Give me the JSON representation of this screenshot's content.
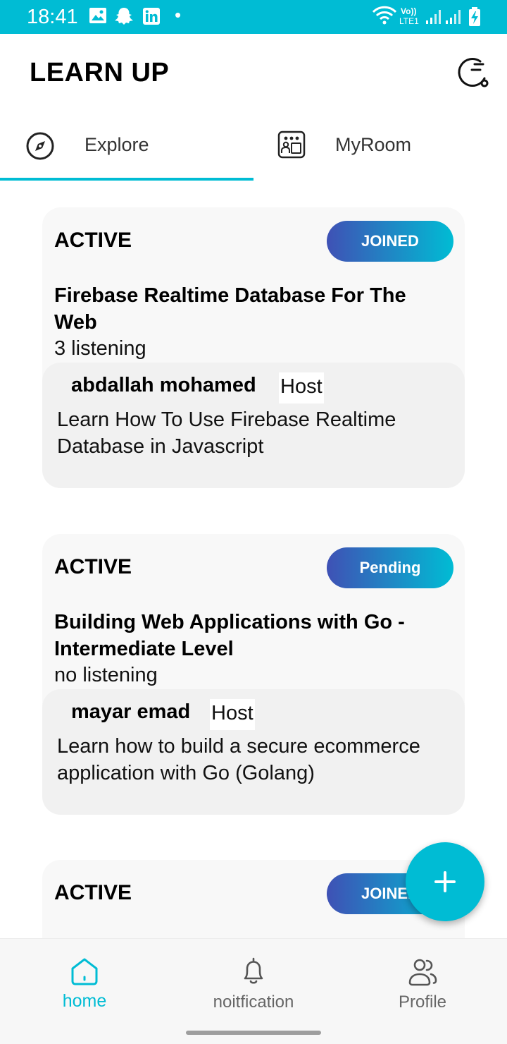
{
  "status_bar": {
    "time": "18:41",
    "volte": "Vo))",
    "lte": "LTE1"
  },
  "app": {
    "title": "LEARN UP"
  },
  "tabs": [
    {
      "label": "Explore",
      "icon": "compass-icon",
      "selected": true
    },
    {
      "label": "MyRoom",
      "icon": "room-icon",
      "selected": false
    }
  ],
  "rooms": [
    {
      "status": "ACTIVE",
      "badge": "JOINED",
      "title": "Firebase Realtime Database For The Web",
      "listening": "3  listening",
      "host_name": "abdallah mohamed",
      "host_tag": "Host",
      "description": "Learn How To Use Firebase Realtime Database in Javascript"
    },
    {
      "status": "ACTIVE",
      "badge": "Pending",
      "title": "Building Web Applications with Go - Intermediate Level",
      "listening": "no listening",
      "host_name": "mayar emad",
      "host_tag": "Host",
      "description": "Learn how to build a secure ecommerce application with Go (Golang)"
    },
    {
      "status": "ACTIVE",
      "badge": "JOINED"
    }
  ],
  "fab": {
    "icon": "plus-icon"
  },
  "bottom_nav": [
    {
      "label": "home",
      "icon": "home-icon",
      "active": true
    },
    {
      "label": "noitfication",
      "icon": "bell-icon",
      "active": false
    },
    {
      "label": "Profile",
      "icon": "users-icon",
      "active": false
    }
  ],
  "colors": {
    "accent": "#00bcd4",
    "gradient_start": "#3f51b5",
    "card_bg": "#f8f8f8",
    "host_box_bg": "#f1f1f1"
  }
}
